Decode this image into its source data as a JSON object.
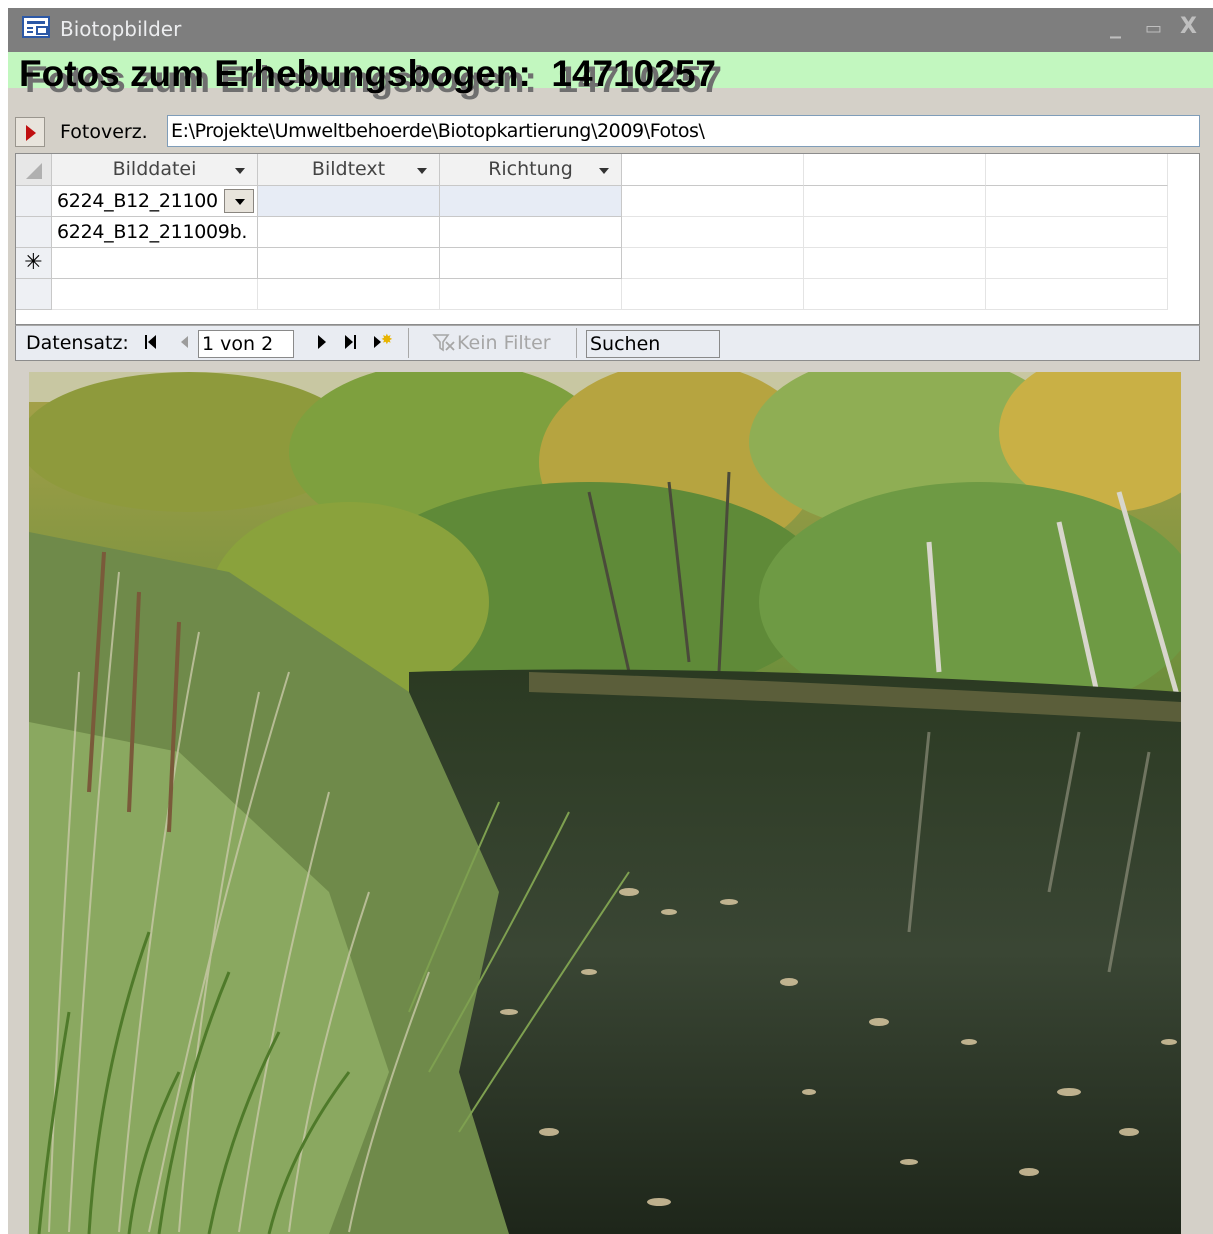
{
  "window": {
    "title": "Biotopbilder",
    "controls": {
      "minimize": "_",
      "maximize": "▭",
      "close": "X"
    }
  },
  "header": {
    "title": "Fotos zum Erhebungsbogen:  14710257"
  },
  "path_row": {
    "label": "Fotoverz.",
    "value": "E:\\Projekte\\Umweltbehoerde\\Biotopkartierung\\2009\\Fotos\\"
  },
  "grid": {
    "columns": [
      "Bilddatei",
      "Bildtext",
      "Richtung"
    ],
    "rows": [
      {
        "bilddatei": "6224_B12_21100",
        "bildtext": "",
        "richtung": ""
      },
      {
        "bilddatei": "6224_B12_211009b.",
        "bildtext": "",
        "richtung": ""
      }
    ],
    "new_row_marker": "✳"
  },
  "navigation": {
    "label": "Datensatz:",
    "record": "1 von 2",
    "filter": "Kein Filter",
    "search": "Suchen"
  },
  "photo": {
    "subject": "pond with reeds and autumn forest"
  },
  "colors": {
    "header_bg": "#c2f7bf",
    "titlebar_bg": "#7e7e7e",
    "window_bg": "#d4d0c8"
  }
}
